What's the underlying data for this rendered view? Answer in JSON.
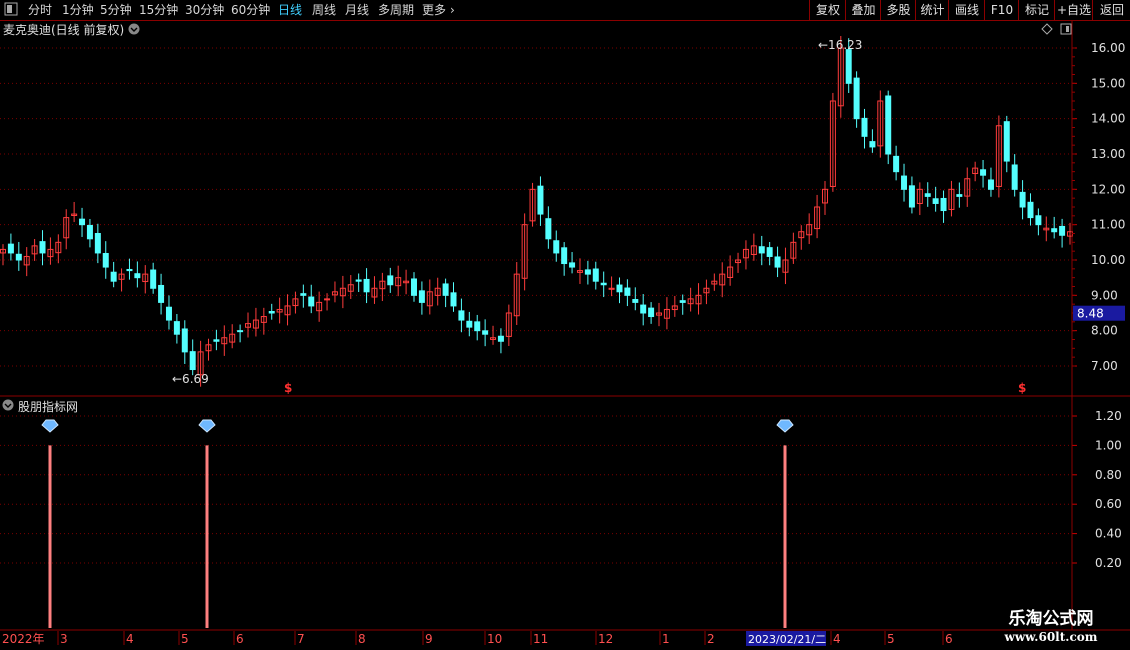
{
  "toolbar": {
    "periods": [
      {
        "label": "分时",
        "active": false
      },
      {
        "label": "1分钟",
        "active": false
      },
      {
        "label": "5分钟",
        "active": false
      },
      {
        "label": "15分钟",
        "active": false
      },
      {
        "label": "30分钟",
        "active": false
      },
      {
        "label": "60分钟",
        "active": false
      },
      {
        "label": "日线",
        "active": true
      },
      {
        "label": "周线",
        "active": false
      },
      {
        "label": "月线",
        "active": false
      },
      {
        "label": "多周期",
        "active": false
      },
      {
        "label": "更多",
        "active": false
      }
    ],
    "right_buttons": [
      "复权",
      "叠加",
      "多股",
      "统计",
      "画线",
      "F10",
      "标记",
      "+自选",
      "返回"
    ]
  },
  "main_panel": {
    "title": "麦克奥迪(日线 前复权)",
    "high_label": "16.23",
    "low_label": "6.69",
    "current_price": "8.48",
    "y_ticks": [
      "16.00",
      "15.00",
      "14.00",
      "13.00",
      "12.00",
      "11.00",
      "10.00",
      "9.00",
      "8.00",
      "7.00"
    ]
  },
  "indicator_panel": {
    "title": "股朋指标网",
    "y_ticks": [
      "1.20",
      "1.00",
      "0.80",
      "0.60",
      "0.40",
      "0.20"
    ]
  },
  "date_axis": {
    "year_label": "2022年",
    "months": [
      "3",
      "4",
      "5",
      "6",
      "7",
      "8",
      "9",
      "10",
      "11",
      "12",
      "1",
      "2",
      "4",
      "5",
      "6"
    ],
    "cursor_date": "2023/02/21/二"
  },
  "watermark": {
    "line1": "乐淘公式网",
    "line2": "www.60lt.com"
  },
  "colors": {
    "up": "#ff3c3c",
    "down": "#54ffff",
    "grid": "#7a0000",
    "signal": "#ff8080"
  },
  "chart_data": {
    "type": "candlestick",
    "x_start": "2022-01",
    "price_range": [
      6.5,
      16.5
    ],
    "price_series_approx": [
      10.3,
      10.2,
      10.0,
      10.1,
      10.4,
      10.2,
      10.3,
      10.5,
      11.2,
      11.3,
      11.0,
      10.6,
      10.2,
      9.8,
      9.4,
      9.6,
      9.7,
      9.5,
      9.6,
      9.2,
      8.8,
      8.3,
      7.9,
      7.4,
      6.9,
      7.4,
      7.6,
      7.7,
      7.8,
      7.9,
      8.0,
      8.2,
      8.3,
      8.4,
      8.5,
      8.6,
      8.7,
      8.9,
      9.0,
      8.7,
      8.8,
      8.9,
      9.1,
      9.2,
      9.3,
      9.4,
      9.1,
      9.2,
      9.4,
      9.3,
      9.5,
      9.4,
      9.0,
      8.8,
      9.1,
      9.2,
      9.0,
      8.7,
      8.3,
      8.1,
      8.0,
      7.9,
      7.8,
      7.7,
      8.5,
      9.6,
      11.0,
      12.0,
      11.3,
      10.6,
      10.2,
      9.9,
      9.8,
      9.7,
      9.6,
      9.4,
      9.3,
      9.2,
      9.1,
      9.0,
      8.8,
      8.5,
      8.4,
      8.5,
      8.6,
      8.7,
      8.8,
      8.9,
      9.0,
      9.2,
      9.4,
      9.6,
      9.8,
      10.0,
      10.3,
      10.4,
      10.2,
      10.1,
      9.8,
      10.0,
      10.5,
      10.8,
      11.0,
      11.5,
      12.0,
      14.5,
      16.0,
      15.0,
      14.0,
      13.5,
      13.2,
      14.5,
      13.0,
      12.5,
      12.0,
      11.5,
      12.0,
      11.8,
      11.6,
      11.4,
      12.0,
      11.8,
      12.3,
      12.6,
      12.4,
      12.0,
      13.8,
      12.8,
      12.0,
      11.5,
      11.2,
      11.0,
      10.9,
      10.8,
      10.7,
      10.8
    ],
    "high": 16.23,
    "low": 6.69,
    "last_price": 8.48,
    "indicator_signals": [
      {
        "position": "2022-02",
        "value": 1.0
      },
      {
        "position": "2022-05",
        "value": 1.0
      },
      {
        "position": "2023-02-21",
        "value": 1.0
      }
    ],
    "indicator_range": [
      0.1,
      1.3
    ]
  }
}
